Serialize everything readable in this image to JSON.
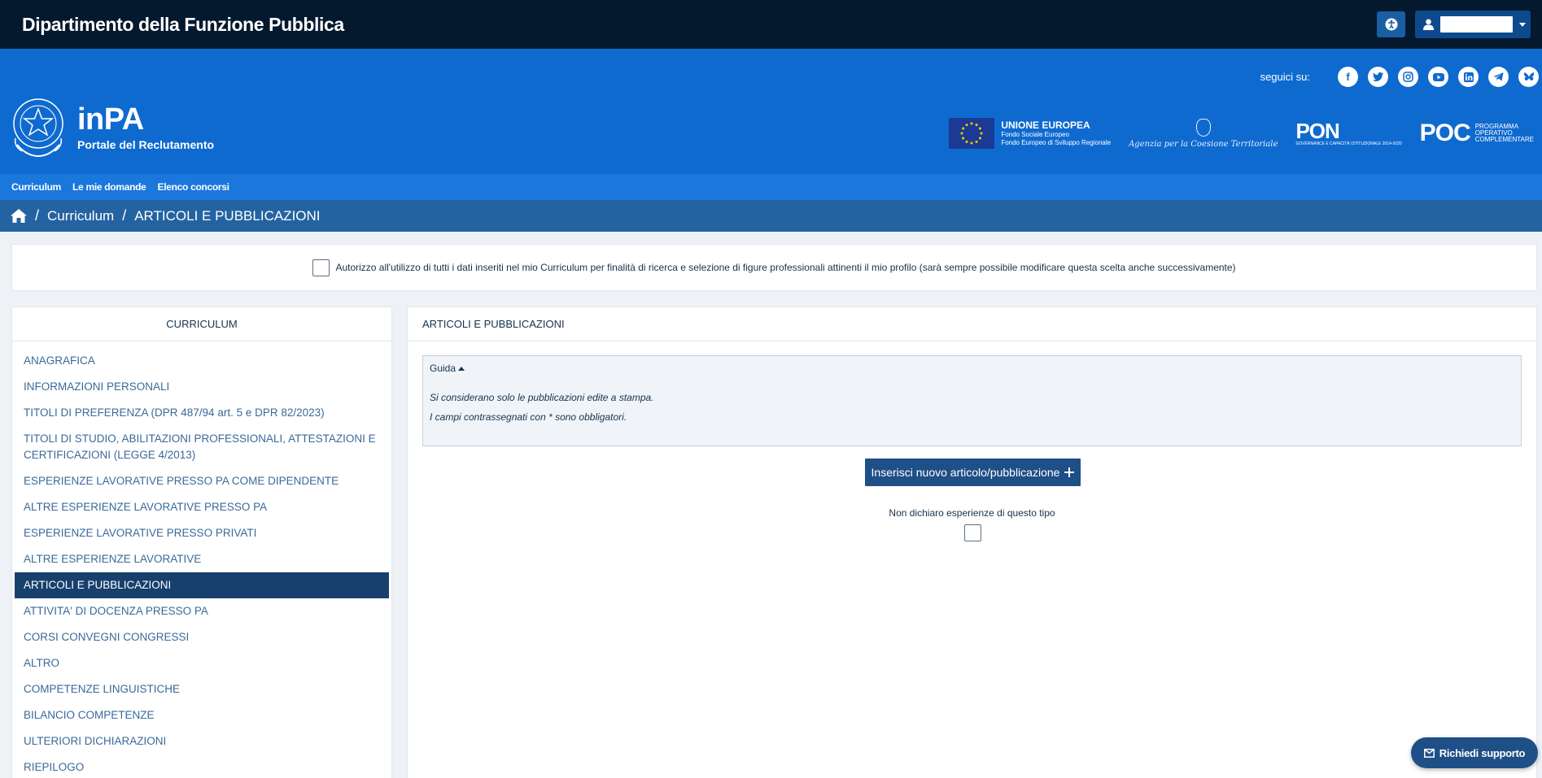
{
  "header": {
    "department": "Dipartimento della Funzione Pubblica",
    "follow_label": "seguici su:",
    "social_icons": [
      "facebook-icon",
      "twitter-icon",
      "instagram-icon",
      "youtube-icon",
      "linkedin-icon",
      "telegram-icon",
      "bluesky-icon"
    ]
  },
  "brand": {
    "title": "inPA",
    "subtitle": "Portale del Reclutamento"
  },
  "logos": {
    "eu_title": "UNIONE EUROPEA",
    "eu_line1": "Fondo Sociale Europeo",
    "eu_line2": "Fondo Europeo di Sviluppo Regionale",
    "agency": "Agenzia per la Coesione Territoriale",
    "pon": "PON",
    "pon_sub": "GOVERNANCE E CAPACITÀ ISTITUZIONALE 2014-2020",
    "poc": "POC",
    "poc_line1": "PROGRAMMA",
    "poc_line2": "OPERATIVO",
    "poc_line3": "COMPLEMENTARE"
  },
  "nav": {
    "items": [
      "Curriculum",
      "Le mie domande",
      "Elenco concorsi"
    ]
  },
  "breadcrumb": {
    "items": [
      "Curriculum",
      "ARTICOLI E PUBBLICAZIONI"
    ],
    "separator": "/"
  },
  "consent": {
    "text": "Autorizzo all'utilizzo di tutti i dati inseriti nel mio Curriculum per finalità di ricerca e selezione di figure professionali attinenti il mio profilo (sarà sempre possibile modificare questa scelta anche successivamente)"
  },
  "sidebar": {
    "title": "CURRICULUM",
    "items": [
      {
        "label": "ANAGRAFICA"
      },
      {
        "label": "INFORMAZIONI PERSONALI"
      },
      {
        "label": "TITOLI DI PREFERENZA (DPR 487/94 art. 5 e DPR 82/2023)"
      },
      {
        "label": "TITOLI DI STUDIO, ABILITAZIONI PROFESSIONALI, ATTESTAZIONI E CERTIFICAZIONI (LEGGE 4/2013)"
      },
      {
        "label": "ESPERIENZE LAVORATIVE PRESSO PA COME DIPENDENTE"
      },
      {
        "label": "ALTRE ESPERIENZE LAVORATIVE PRESSO PA"
      },
      {
        "label": "ESPERIENZE LAVORATIVE PRESSO PRIVATI"
      },
      {
        "label": "ALTRE ESPERIENZE LAVORATIVE"
      },
      {
        "label": "ARTICOLI E PUBBLICAZIONI"
      },
      {
        "label": "ATTIVITA' DI DOCENZA PRESSO PA"
      },
      {
        "label": "CORSI CONVEGNI CONGRESSI"
      },
      {
        "label": "ALTRO"
      },
      {
        "label": "COMPETENZE LINGUISTICHE"
      },
      {
        "label": "BILANCIO COMPETENZE"
      },
      {
        "label": "ULTERIORI DICHIARAZIONI"
      },
      {
        "label": "RIEPILOGO"
      }
    ],
    "active_index": 8
  },
  "main": {
    "title": "ARTICOLI E PUBBLICAZIONI",
    "guide_title": "Guida",
    "guide_line1": "Si considerano solo le pubblicazioni edite a stampa.",
    "guide_line2": "I campi contrassegnati con * sono obbligatori.",
    "new_button": "Inserisci nuovo articolo/pubblicazione",
    "no_declare": "Non dichiaro esperienze di questo tipo"
  },
  "support": {
    "label": "Richiedi supporto"
  },
  "colors": {
    "top_bar": "#04192e",
    "header_blue": "#0f6ad0",
    "nav_blue": "#1a77dc",
    "breadcrumb_blue": "#2463a1",
    "active_item": "#17406d",
    "button": "#1f4f87"
  }
}
